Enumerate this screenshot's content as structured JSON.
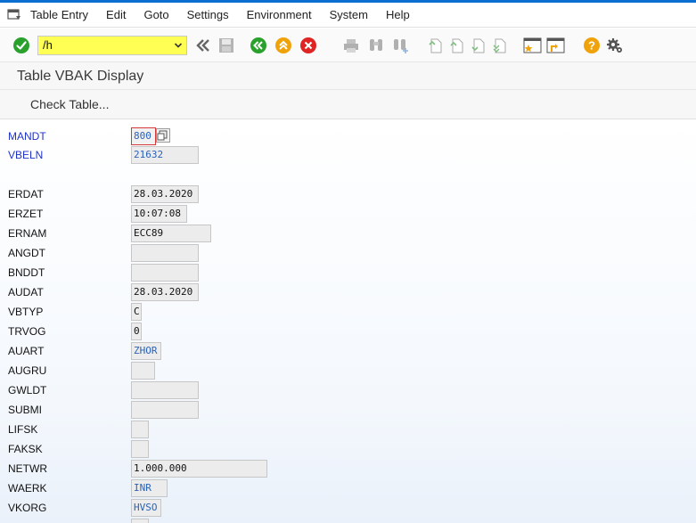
{
  "menubar": {
    "items": [
      {
        "label": "Table Entry"
      },
      {
        "label": "Edit"
      },
      {
        "label": "Goto"
      },
      {
        "label": "Settings"
      },
      {
        "label": "Environment"
      },
      {
        "label": "System"
      },
      {
        "label": "Help"
      }
    ]
  },
  "toolbar": {
    "command_value": "/h",
    "colors": {
      "enter": "#2aa12c",
      "back": "#2aa12c",
      "exit": "#f0a20b",
      "cancel": "#e02424",
      "help": "#f0a20b",
      "command_highlight": "#ffff54"
    }
  },
  "title": "Table VBAK Display",
  "app_toolbar": {
    "check_table_label": "Check Table..."
  },
  "fields": [
    {
      "name": "MANDT",
      "value": "800",
      "key": true
    },
    {
      "name": "VBELN",
      "value": "21632",
      "key": true
    },
    {
      "name": "ERDAT",
      "value": "28.03.2020",
      "key": false
    },
    {
      "name": "ERZET",
      "value": "10:07:08",
      "key": false
    },
    {
      "name": "ERNAM",
      "value": "ECC89",
      "key": false
    },
    {
      "name": "ANGDT",
      "value": "",
      "key": false
    },
    {
      "name": "BNDDT",
      "value": "",
      "key": false
    },
    {
      "name": "AUDAT",
      "value": "28.03.2020",
      "key": false
    },
    {
      "name": "VBTYP",
      "value": "C",
      "key": false
    },
    {
      "name": "TRVOG",
      "value": "0",
      "key": false
    },
    {
      "name": "AUART",
      "value": "ZHOR",
      "key": false
    },
    {
      "name": "AUGRU",
      "value": "",
      "key": false
    },
    {
      "name": "GWLDT",
      "value": "",
      "key": false
    },
    {
      "name": "SUBMI",
      "value": "",
      "key": false
    },
    {
      "name": "LIFSK",
      "value": "",
      "key": false
    },
    {
      "name": "FAKSK",
      "value": "",
      "key": false
    },
    {
      "name": "NETWR",
      "value": "1.000.000",
      "key": false
    },
    {
      "name": "WAERK",
      "value": "INR",
      "key": false
    },
    {
      "name": "VKORG",
      "value": "HVSO",
      "key": false
    }
  ]
}
